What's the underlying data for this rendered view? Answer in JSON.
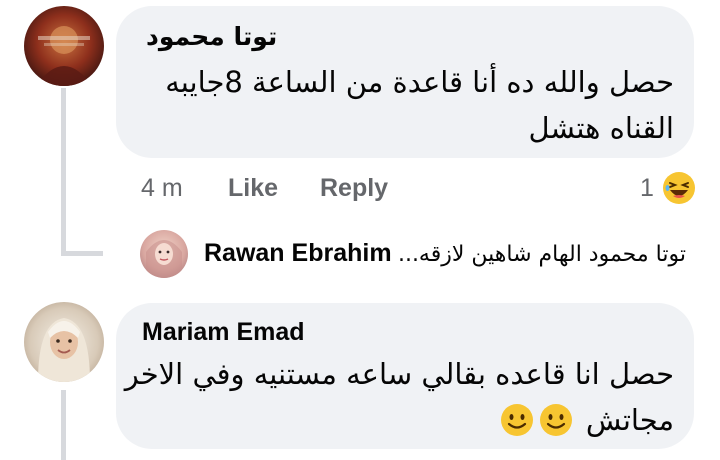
{
  "comments": [
    {
      "author": "توتا محمود",
      "text_line1": "حصل والله ده أنا قاعدة من الساعة 8جايبه",
      "text_line2": "القناه هتشل",
      "time": "4 m",
      "like_label": "Like",
      "reply_label": "Reply",
      "reaction_count": "1",
      "reaction_icon": "laughing-face-icon",
      "reply_preview": {
        "name": "Rawan Ebrahim",
        "text": "توتا محمود الهام شاهين لازقه..."
      }
    },
    {
      "author": "Mariam Emad",
      "text_line1": "حصل انا قاعده بقالي ساعه مستنيه وفي الاخر",
      "text_line2": "مجاتش",
      "emoji_icons": [
        "slightly-smiling-face-icon",
        "slightly-smiling-face-icon"
      ]
    }
  ],
  "colors": {
    "bubble": "#f0f2f5",
    "secondary_text": "#65676b",
    "thread_line": "#d7d9dd",
    "emoji_yellow": "#f7c531"
  }
}
